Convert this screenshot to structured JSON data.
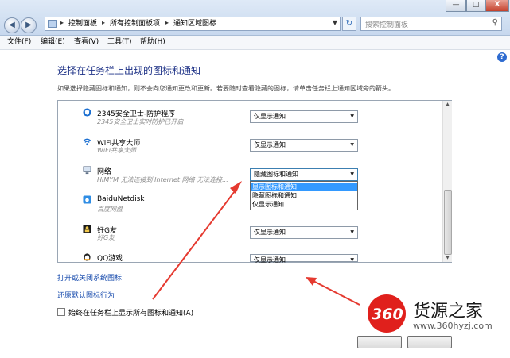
{
  "window": {
    "breadcrumb": [
      "控制面板",
      "所有控制面板项",
      "通知区域图标"
    ],
    "search_placeholder": "搜索控制面板",
    "min": "—",
    "max": "□",
    "close": "X"
  },
  "menu": [
    "文件(F)",
    "编辑(E)",
    "查看(V)",
    "工具(T)",
    "帮助(H)"
  ],
  "page": {
    "title": "选择在任务栏上出现的图标和通知",
    "description": "如果选择隐藏图标和通知，则不会向您通知更改和更新。若要随时查看隐藏的图标，请单击任务栏上通知区域旁的箭头。"
  },
  "apps": [
    {
      "name": "2345安全卫士-防护程序",
      "sub": "2345安全卫士实时防护已开启",
      "behavior": "仅显示通知"
    },
    {
      "name": "WiFi共享大师",
      "sub": "WiFi共享大师",
      "behavior": "仅显示通知"
    },
    {
      "name": "网络",
      "sub": "HIMYM 无法连接到 Internet 网络 无法连接...",
      "behavior": "隐藏图标和通知"
    },
    {
      "name": "BaiduNetdisk",
      "sub": "百度网盘",
      "behavior": ""
    },
    {
      "name": "好G友",
      "sub": "好G友",
      "behavior": "仅显示通知"
    },
    {
      "name": "QQ游戏",
      "sub": "",
      "behavior": "仅显示通知"
    }
  ],
  "dropdown_options": [
    "显示图标和通知",
    "隐藏图标和通知",
    "仅显示通知"
  ],
  "dropdown_selected": "显示图标和通知",
  "links": {
    "system_icons": "打开或关闭系统图标",
    "restore_default": "还原默认图标行为"
  },
  "always_show": {
    "label": "始终在任务栏上显示所有图标和通知(A)",
    "checked": false
  },
  "watermark": {
    "number": "360",
    "text": "货源之家",
    "url": "www.360hyzj.com"
  },
  "colors": {
    "title": "#1e3287",
    "link": "#1a4dae",
    "selection": "#3399ff",
    "arrow": "#e53a30",
    "logo": "#e0201c"
  }
}
